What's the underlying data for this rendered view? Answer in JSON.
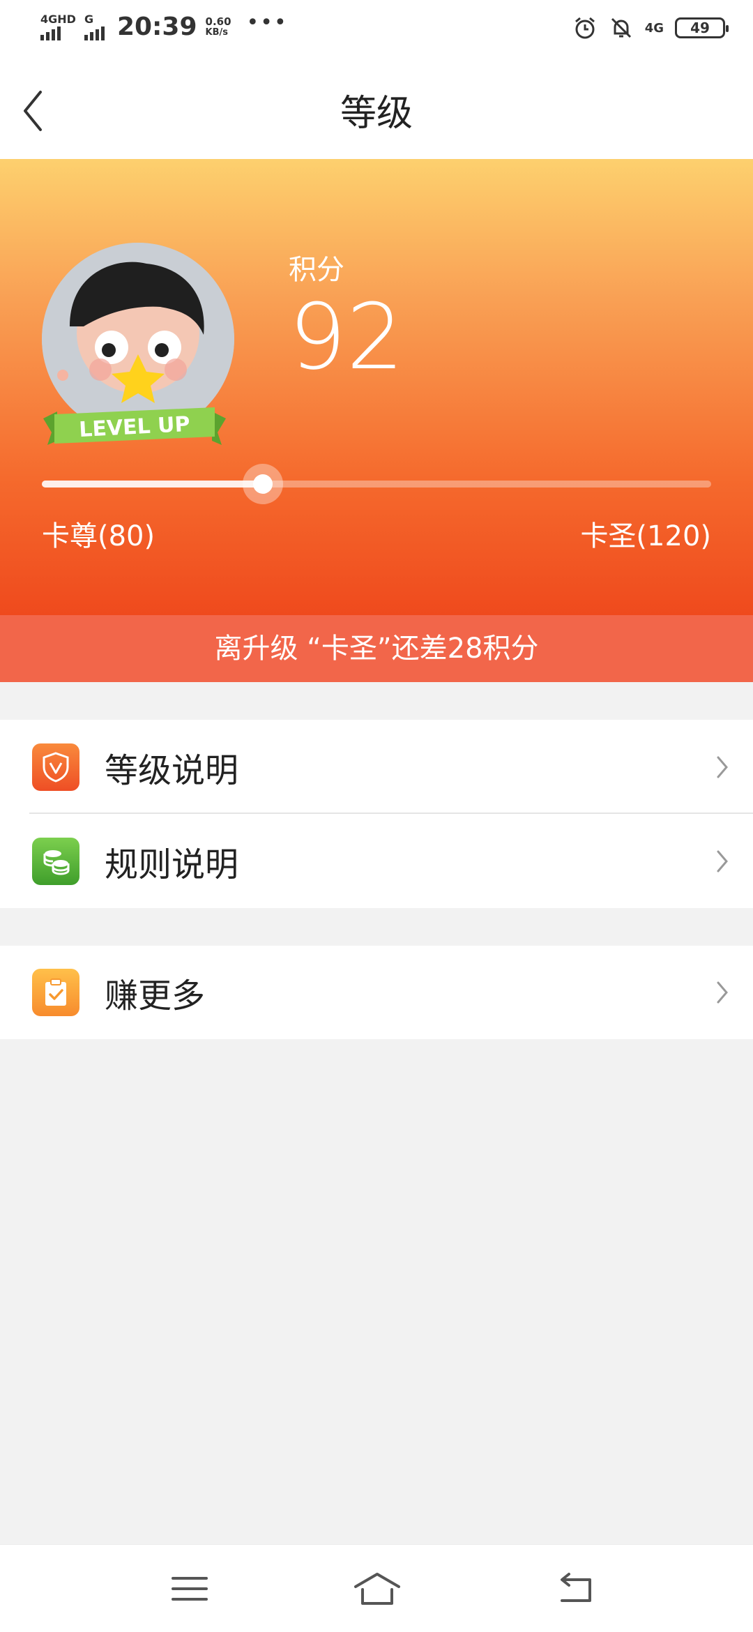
{
  "status_bar": {
    "signal1_label": "4GHD",
    "signal2_label": "G",
    "time": "20:39",
    "speed_value": "0.60",
    "speed_unit": "KB/s",
    "more": "•••",
    "network": "4G",
    "battery": "49"
  },
  "header": {
    "title": "等级"
  },
  "hero": {
    "badge_text": "LEVEL UP",
    "points_label": "积分",
    "points_value": "92",
    "current_level": "卡尊(80)",
    "next_level": "卡圣(120)",
    "progress": 0.33,
    "upgrade_message": "离升级 “卡圣”还差28积分"
  },
  "menu": {
    "items": [
      {
        "label": "等级说明",
        "icon": "shield-v-icon"
      },
      {
        "label": "规则说明",
        "icon": "coins-icon"
      }
    ],
    "earn_more": {
      "label": "赚更多",
      "icon": "clipboard-check-icon"
    }
  },
  "colors": {
    "hero_top": "#fdd06e",
    "hero_bottom": "#ef4a1d",
    "banner": "#f2664a"
  }
}
